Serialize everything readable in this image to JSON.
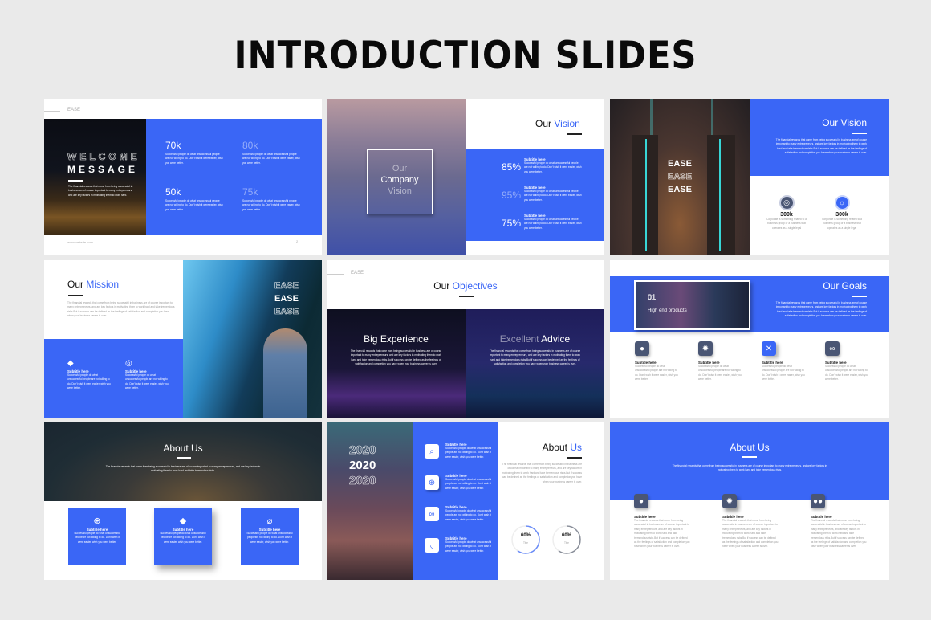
{
  "page": {
    "title": "INTRODUCTION SLIDES"
  },
  "colors": {
    "accent": "#3a66f6",
    "background": "#eaeaea",
    "icon_dark": "#4a5674"
  },
  "lorem": {
    "short": "Successful people do what unsuccessful people are not willing to do. Don't wish it were easier, wish you were better.",
    "long": "The financial rewards that come from being successful in business are of course important to many entrepreneurs, and are key factors in motivating them to work hard and take tremendous risks.But if success can be defined as the feelings of satisfaction and completion you have when your business career is over.",
    "corp": "Corporate is something related to a business group or a business that operates as a single legal"
  },
  "slides": {
    "welcome": {
      "brand": "EASE",
      "title_1": "WELCOME",
      "title_2": "MESSAGE",
      "body": "The financial rewards that come from being successful in business are of course important to many entrepreneurs, and are key factors in motivating them to work hard.",
      "stats": [
        {
          "value": "70k",
          "text": "Successful people do what unsuccessful people are not willing to do. Don't wish it were easier, wish you were better."
        },
        {
          "value": "80k",
          "text": "Successful people do what unsuccessful people are not willing to do. Don't wish it were easier, wish you were better."
        },
        {
          "value": "50k",
          "text": "Successful people do what unsuccessful people are not willing to do. Don't wish it were easier, wish you were better."
        },
        {
          "value": "75k",
          "text": "Successful people do what unsuccessful people are not willing to do. Don't wish it were easier, wish you were better."
        }
      ],
      "footer_url": "www.website.com",
      "page_number": "2"
    },
    "company_vision": {
      "overlay_1": "Our",
      "overlay_2": "Company",
      "overlay_3": "Vision",
      "title_a": "Our",
      "title_b": "Vision",
      "items": [
        {
          "value": "85%",
          "subtitle": "Subtitle here",
          "text": "Successful people do what unsuccessful people are not willing to do. Don't wish it were easier, wish you were better."
        },
        {
          "value": "95%",
          "subtitle": "Subtitle here",
          "text": "Successful people do what unsuccessful people are not willing to do. Don't wish it were easier, wish you were better."
        },
        {
          "value": "75%",
          "subtitle": "Subtitle here",
          "text": "Successful people do what unsuccessful people are not willing to do. Don't wish it were easier, wish you were better."
        }
      ]
    },
    "vision": {
      "ease": [
        "EASE",
        "EASE",
        "EASE"
      ],
      "title": "Our Vision",
      "body": "The financial rewards that come from being successful in business are of course important to many entrepreneurs, and are key factors in motivating them to work hard and take tremendous risks.But if success can be defined as the feelings of satisfaction and completion you have when your business career is over.",
      "stats": [
        {
          "icon": "target-icon",
          "value": "300k",
          "text": "Corporate is something related to a business group or a business that operates as a single legal"
        },
        {
          "icon": "lightbulb-icon",
          "value": "300k",
          "text": "Corporate is something related to a business group or a business that operates as a single legal"
        }
      ]
    },
    "mission": {
      "title_a": "Our",
      "title_b": "Mission",
      "body": "The financial rewards that come from being successful in business are of course important to many entrepreneurs, and are key factors in motivating them to work hard and take tremendous risks.But if success can be defined as the feelings of satisfaction and completion you have when your business career is over.",
      "ease": [
        "EASE",
        "EASE",
        "EASE"
      ],
      "items": [
        {
          "icon": "diamond-icon",
          "subtitle": "Subtitle here",
          "text": "Successful people do what unsuccessful people are not willing to do. Don't wish it were easier, wish you were better."
        },
        {
          "icon": "target-icon",
          "subtitle": "Subtitle here",
          "text": "Successful people do what unsuccessful people are not willing to do. Don't wish it were easier, wish you were better."
        }
      ]
    },
    "objectives": {
      "brand": "EASE",
      "title_a": "Our",
      "title_b": "Objectives",
      "panels": [
        {
          "title": "Big Experience",
          "text": "The financial rewards that come from being successful in business are of course important to many entrepreneurs, and are key factors in motivating them to work hard and take tremendous risks.But if success can be defined as the feelings of satisfaction and completion you have when your business career is over."
        },
        {
          "title_faded": "Excellent",
          "title": "Advice",
          "text": "The financial rewards that come from being successful in business are of course important to many entrepreneurs, and are key factors in motivating them to work hard and take tremendous risks.But if success can be defined as the feelings of satisfaction and completion you have when your business career is over."
        }
      ]
    },
    "goals": {
      "number": "01",
      "caption": "High end products",
      "title": "Our Goals",
      "body": "The financial rewards that come from being successful in business are of course important to many entrepreneurs, and are key factors in motivating them to work hard and take tremendous risks.But if success can be defined as the feelings of satisfaction and completion you have when your business career is over.",
      "items": [
        {
          "icon": "user-icon",
          "subtitle": "Subtitle here",
          "text": "Successful people do what unsuccessful people are not willing to do. Don't wish it were easier, wish you were better."
        },
        {
          "icon": "gear-icon",
          "subtitle": "Subtitle here",
          "text": "Successful people do what unsuccessful people are not willing to do. Don't wish it were easier, wish you were better."
        },
        {
          "icon": "close-icon",
          "subtitle": "Subtitle here",
          "text": "Successful people do what unsuccessful people are not willing to do. Don't wish it were easier, wish you were better."
        },
        {
          "icon": "link-icon",
          "subtitle": "Subtitle here",
          "text": "Successful people do what unsuccessful people are not willing to do. Don't wish it were easier, wish you were better."
        }
      ]
    },
    "about_photo": {
      "title": "About Us",
      "body": "The financial rewards that come from being successful in business are of course important to many entrepreneurs, and are key factors in motivating them to work hard and take tremendous risks.",
      "cards": [
        {
          "icon": "globe-icon",
          "subtitle": "Subtitle here",
          "text": "Successful people do what unsuccessful peoplesre not willing to do. Don't wish it were easier, wish you were better."
        },
        {
          "icon": "diamond-icon",
          "subtitle": "Subtitle here",
          "text": "Successful people do what unsuccessful peoplesre not willing to do. Don't wish it were easier, wish you were better."
        },
        {
          "icon": "paperclip-icon",
          "subtitle": "Subtitle here",
          "text": "Successful people do what unsuccessful peoplesre not willing to do. Don't wish it were easier, wish you were better."
        }
      ]
    },
    "about_2020": {
      "years": [
        "2020",
        "2020",
        "2020"
      ],
      "items": [
        {
          "icon": "search-icon",
          "subtitle": "Subtitle here",
          "text": "Successful people do what unsuccessful people are not willing to do. Don't wish it were easier, wish you were better."
        },
        {
          "icon": "zoom-in-icon",
          "subtitle": "Subtitle here",
          "text": "Successful people do what unsuccessful people are not willing to do. Don't wish it were easier, wish you were better."
        },
        {
          "icon": "link-icon",
          "subtitle": "Subtitle here",
          "text": "Successful people do what unsuccessful people are not willing to do. Don't wish it were easier, wish you were better."
        },
        {
          "icon": "rss-icon",
          "subtitle": "Subtitle here",
          "text": "Successful people do what unsuccessful people are not willing to do. Don't wish it were easier, wish you were better."
        }
      ],
      "title_a": "About",
      "title_b": "Us",
      "body": "The financial rewards that come from being successful in business are of course important to many entrepreneurs, and are key factors in motivating them to work hard and take tremendous risks.But if success can be defined as the feelings of satisfaction and completion you have when your business career is over.",
      "gauges": [
        {
          "value": "60%",
          "label": "Title",
          "fraction": 0.6
        },
        {
          "value": "60%",
          "label": "Title",
          "fraction": 0.6
        }
      ]
    },
    "about_blue": {
      "title": "About Us",
      "body": "The financial rewards that come from being successful in business are of course important to many entrepreneurs, and are key factors in motivating them to work hard and take tremendous risks.",
      "items": [
        {
          "icon": "user-icon",
          "subtitle": "Subtitle here",
          "text": "The financial rewards that come from being successful in business are of course important to many entrepreneurs, and are key factors in motivating them to work hard and take tremendous risks.But if success can be defined as the feelings of satisfaction and completion you have when your business career is over."
        },
        {
          "icon": "gear-icon",
          "subtitle": "Subtitle here",
          "text": "The financial rewards that come from being successful in business are of course important to many entrepreneurs, and are key factors in motivating them to work hard and take tremendous risks.But if success can be defined as the feelings of satisfaction and completion you have when your business career is over."
        },
        {
          "icon": "team-icon",
          "subtitle": "Subtitle here",
          "text": "The financial rewards that come from being successful in business are of course important to many entrepreneurs, and are key factors in motivating them to work hard and take tremendous risks.But if success can be defined as the feelings of satisfaction and completion you have when your business career is over."
        }
      ]
    }
  }
}
